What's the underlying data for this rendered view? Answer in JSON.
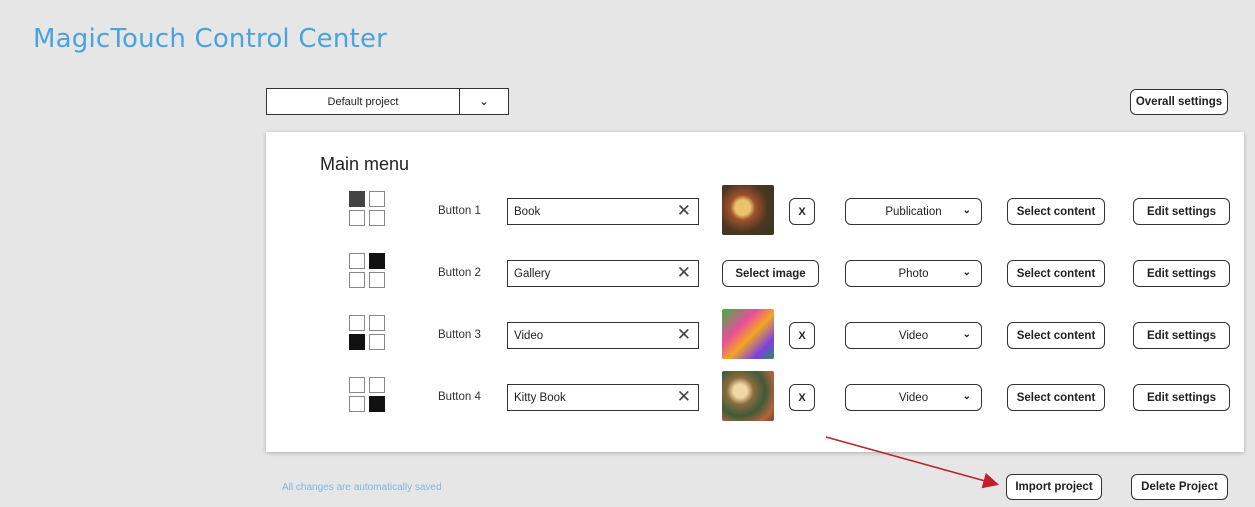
{
  "app": {
    "title": "MagicTouch Control Center"
  },
  "toolbar": {
    "project": "Default project",
    "overall_settings": "Overall settings"
  },
  "panel": {
    "title": "Main menu",
    "rows": [
      {
        "label": "Button 1",
        "name": "Book",
        "image": "thumbnail",
        "remove": "X",
        "type": "Publication",
        "select_content": "Select content",
        "edit_settings": "Edit settings"
      },
      {
        "label": "Button 2",
        "name": "Gallery",
        "image_button": "Select image",
        "type": "Photo",
        "select_content": "Select content",
        "edit_settings": "Edit settings"
      },
      {
        "label": "Button 3",
        "name": "Video",
        "image": "thumbnail",
        "remove": "X",
        "type": "Video",
        "select_content": "Select content",
        "edit_settings": "Edit settings"
      },
      {
        "label": "Button 4",
        "name": "Kitty Book",
        "image": "thumbnail",
        "remove": "X",
        "type": "Video",
        "select_content": "Select content",
        "edit_settings": "Edit settings"
      }
    ]
  },
  "footer": {
    "note": "All changes are automatically saved",
    "import_project": "Import project",
    "delete_project": "Delete Project"
  },
  "colors": {
    "title": "#4aa3df",
    "note": "#7fb7e0",
    "arrow": "#c0202a"
  }
}
